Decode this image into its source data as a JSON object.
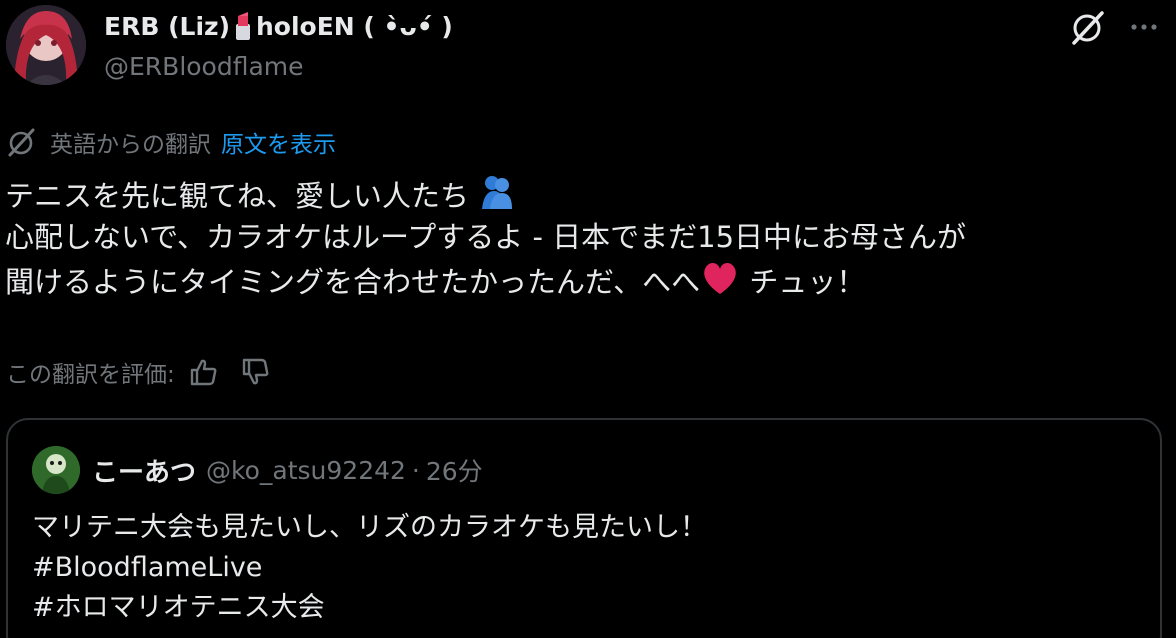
{
  "author": {
    "name_part1": "ERB (Liz)",
    "lipstick_emoji": "lipstick",
    "name_part2": "holoEN ( •̀ᴗ•́ )",
    "handle": "@ERBloodflame"
  },
  "icons": {
    "grok": "grok-icon",
    "more": "more-icon",
    "translate": "translate-icon",
    "thumbs_up": "thumbs-up-icon",
    "thumbs_down": "thumbs-down-icon"
  },
  "translation": {
    "label": "英語からの翻訳",
    "show_original": "原文を表示"
  },
  "tweet": {
    "line1": "テニスを先に観てね、愛しい人たち",
    "line2": "心配しないで、カラオケはループするよ - 日本でまだ15日中にお母さんが",
    "line3": "聞けるようにタイミングを合わせたかったんだ、へへ",
    "line3_end": "チュッ！"
  },
  "rating": {
    "label": "この翻訳を評価:"
  },
  "quote": {
    "name": "こーあつ",
    "handle": "@ko_atsu92242",
    "separator": "·",
    "time": "26分",
    "line1": "マリテニ大会も見たいし、リズのカラオケも見たいし！",
    "line2": "#BloodflameLive",
    "line3": "#ホロマリオテニス大会"
  },
  "colors": {
    "background": "#000000",
    "text": "#e7e9ea",
    "secondary": "#71767b",
    "link": "#1d9bf0",
    "border": "#2f3336",
    "heart": "#e0245e"
  }
}
